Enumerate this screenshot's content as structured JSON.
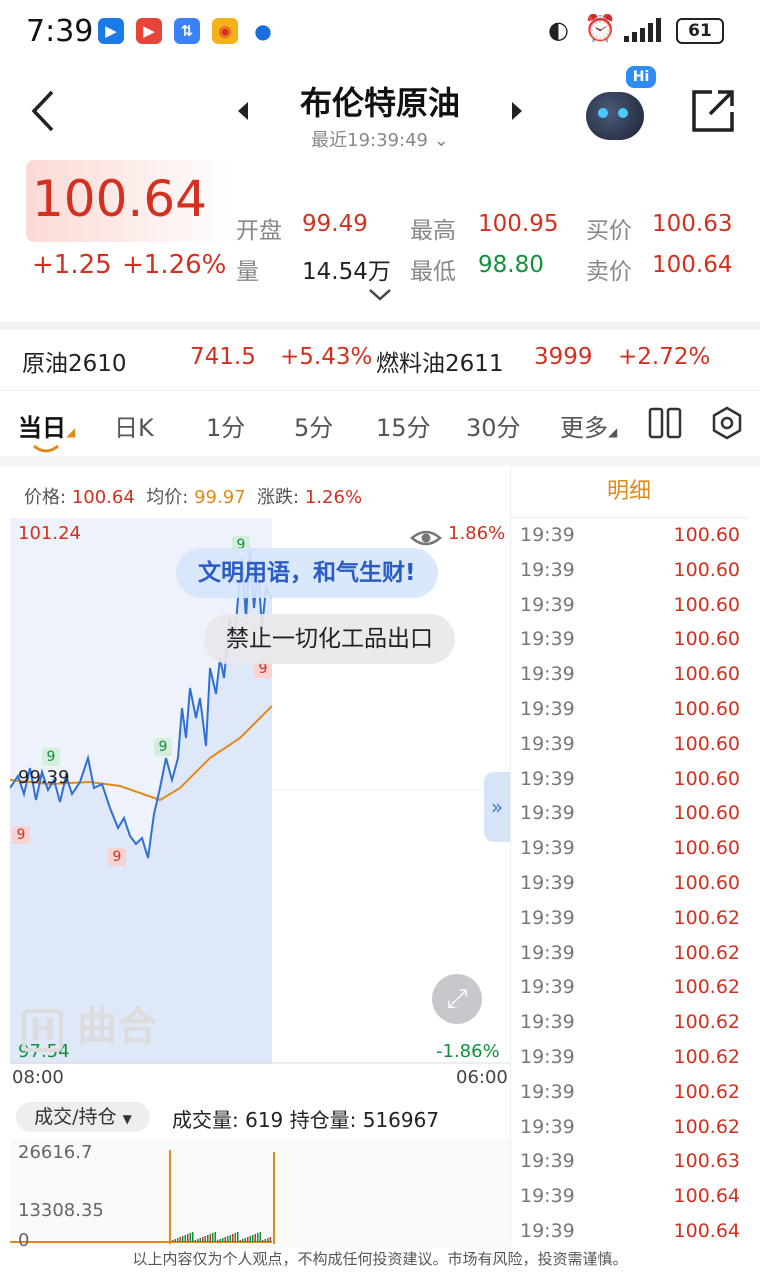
{
  "status_bar": {
    "time": "7:39",
    "battery": "61",
    "app_icons": [
      "bilibili-style-icon",
      "video-icon",
      "transfer-icon",
      "weibo-icon",
      "browser-icon"
    ]
  },
  "header": {
    "title": "布伦特原油",
    "subtitle": "最近19:39:49"
  },
  "quote": {
    "price": "100.64",
    "change": "+1.25",
    "change_pct": "+1.26%",
    "open_label": "开盘",
    "open": "99.49",
    "high_label": "最高",
    "high": "100.95",
    "bid_label": "买价",
    "bid": "100.63",
    "volume_label": "量",
    "volume": "14.54万",
    "low_label": "最低",
    "low": "98.80",
    "ask_label": "卖价",
    "ask": "100.64"
  },
  "related": [
    {
      "name": "原油2610",
      "price": "741.5",
      "pct": "+5.43%"
    },
    {
      "name": "燃料油2611",
      "price": "3999",
      "pct": "+2.72%"
    }
  ],
  "tabs": [
    "当日",
    "日K",
    "1分",
    "5分",
    "15分",
    "30分",
    "更多"
  ],
  "chart_info": {
    "price_label": "价格:",
    "price": "100.64",
    "avg_label": "均价:",
    "avg": "99.97",
    "chg_label": "涨跌:",
    "chg": "1.26%"
  },
  "chart_labels": {
    "top": "101.24",
    "mid": "99.39",
    "bottom": "97.54",
    "top_pct": "1.86%",
    "bottom_pct": "-1.86%",
    "start": "08:00",
    "end": "06:00",
    "marker": "9"
  },
  "bubbles": {
    "first": "文明用语，和气生财!",
    "second": "禁止一切化工品出口"
  },
  "watermark": "曲合",
  "volume_panel": {
    "selector": "成交/持仓",
    "summary": "成交量: 619 持仓量: 516967",
    "top": "26616.7",
    "mid": "13308.35",
    "bottom": "0"
  },
  "detail": {
    "title": "明细",
    "rows": [
      {
        "time": "19:39",
        "price": "100.60"
      },
      {
        "time": "19:39",
        "price": "100.60"
      },
      {
        "time": "19:39",
        "price": "100.60"
      },
      {
        "time": "19:39",
        "price": "100.60"
      },
      {
        "time": "19:39",
        "price": "100.60"
      },
      {
        "time": "19:39",
        "price": "100.60"
      },
      {
        "time": "19:39",
        "price": "100.60"
      },
      {
        "time": "19:39",
        "price": "100.60"
      },
      {
        "time": "19:39",
        "price": "100.60"
      },
      {
        "time": "19:39",
        "price": "100.60"
      },
      {
        "time": "19:39",
        "price": "100.60"
      },
      {
        "time": "19:39",
        "price": "100.62"
      },
      {
        "time": "19:39",
        "price": "100.62"
      },
      {
        "time": "19:39",
        "price": "100.62"
      },
      {
        "time": "19:39",
        "price": "100.62"
      },
      {
        "time": "19:39",
        "price": "100.62"
      },
      {
        "time": "19:39",
        "price": "100.62"
      },
      {
        "time": "19:39",
        "price": "100.62"
      },
      {
        "time": "19:39",
        "price": "100.63"
      },
      {
        "time": "19:39",
        "price": "100.64"
      },
      {
        "time": "19:39",
        "price": "100.64"
      }
    ]
  },
  "disclaimer": "以上内容仅为个人观点，不构成任何投资建议。市场有风险，投资需谨慎。",
  "colors": {
    "up": "#d4301f",
    "down": "#12913d",
    "accent": "#e08a1b",
    "line": "#2f6fd6"
  }
}
